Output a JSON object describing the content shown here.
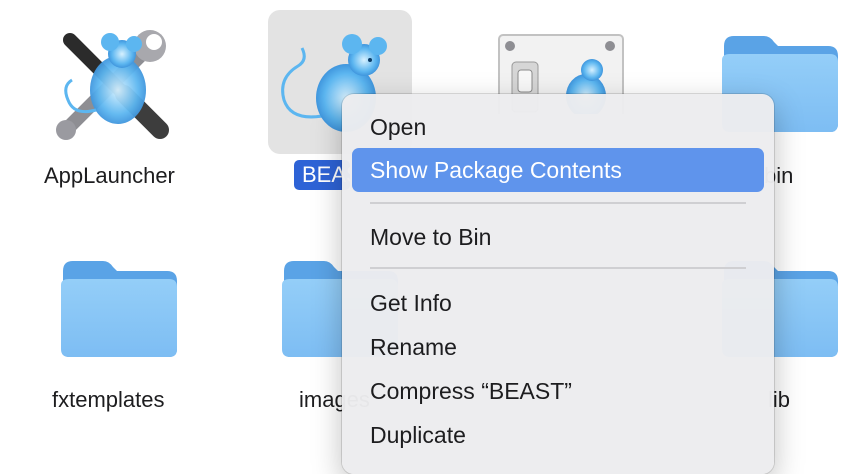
{
  "files": [
    {
      "id": "applauncher",
      "label": "AppLauncher",
      "icon": "beast-tools-app-icon"
    },
    {
      "id": "beast",
      "label": "BEAST",
      "icon": "beast-mouse-app-icon",
      "selected": true
    },
    {
      "id": "switch",
      "label": "",
      "icon": "beast-switch-app-icon"
    },
    {
      "id": "bin",
      "label": "bin",
      "icon": "folder-icon"
    },
    {
      "id": "fxtemplates",
      "label": "fxtemplates",
      "icon": "folder-icon"
    },
    {
      "id": "images",
      "label": "images",
      "icon": "folder-icon"
    },
    {
      "id": "lib",
      "label": "lib",
      "icon": "folder-icon"
    }
  ],
  "context_menu": {
    "items": [
      {
        "label": "Open"
      },
      {
        "label": "Show Package Contents",
        "highlighted": true
      },
      {
        "label": "Move to Bin"
      },
      {
        "label": "Get Info"
      },
      {
        "label": "Rename"
      },
      {
        "label": "Compress “BEAST”"
      },
      {
        "label": "Duplicate"
      }
    ]
  },
  "colors": {
    "selection": "#2e63d6",
    "menu_highlight": "#5f94ec",
    "folder_light": "#8cc8f6",
    "folder_dark": "#5aa3e6"
  }
}
